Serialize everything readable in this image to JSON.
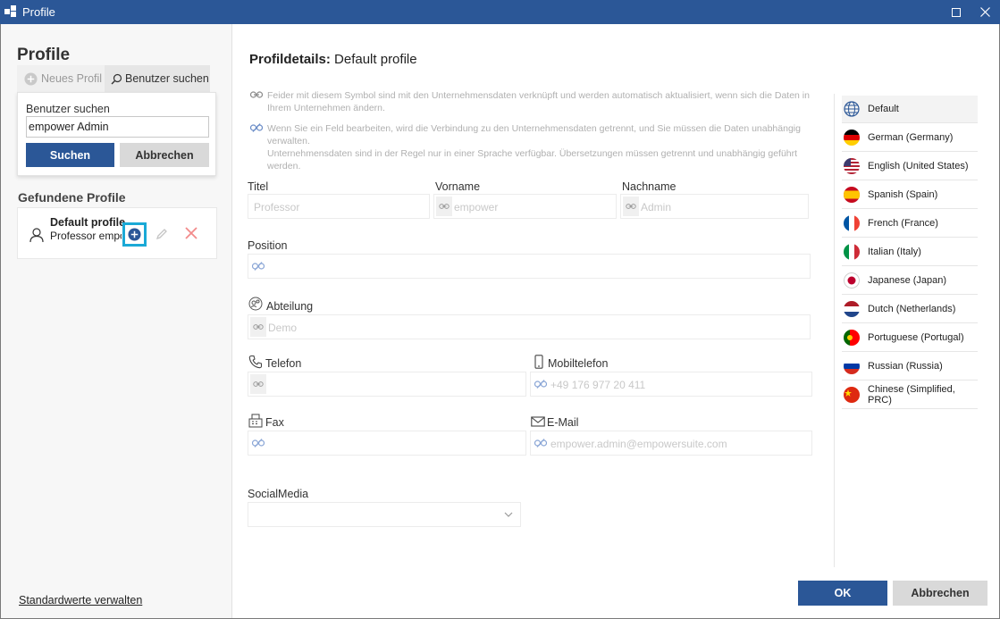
{
  "window": {
    "title": "Profile"
  },
  "left": {
    "heading": "Profile",
    "tabs": {
      "new_profile": "Neues Profil",
      "search_user": "Benutzer suchen"
    },
    "search": {
      "label": "Benutzer suchen",
      "value": "empower Admin",
      "search_button": "Suchen",
      "cancel_button": "Abbrechen"
    },
    "found_title": "Gefundene Profile",
    "result": {
      "name": "Default profile",
      "subtitle": "Professor empower Admin"
    },
    "defaults_link": "Standardwerte verwalten"
  },
  "main": {
    "heading_bold": "Profildetails:",
    "heading_value": " Default profile",
    "info_linked": "Feider mit diesem Symbol sind mit den Unternehmensdaten verknüpft und werden automatisch aktualisiert, wenn sich die Daten in Ihrem Unternehmen ändern.",
    "info_broken_1": "Wenn Sie ein Feld bearbeiten, wird die Verbindung zu den Unternehmensdaten getrennt, und Sie müssen die Daten unabhängig verwalten.",
    "info_broken_2": "Unternehmensdaten sind in der Regel nur in einer Sprache verfügbar. Übersetzungen müssen getrennt und unabhängig geführt werden.",
    "fields": {
      "titel": {
        "label": "Titel",
        "value": "Professor"
      },
      "vorname": {
        "label": "Vorname",
        "value": "empower"
      },
      "nachname": {
        "label": "Nachname",
        "value": "Admin"
      },
      "position": {
        "label": "Position",
        "value": ""
      },
      "abteilung": {
        "label": "Abteilung",
        "value": "Demo"
      },
      "telefon": {
        "label": "Telefon",
        "value": ""
      },
      "mobil": {
        "label": "Mobiltelefon",
        "value": "+49 176 977 20 411"
      },
      "fax": {
        "label": "Fax",
        "value": ""
      },
      "email": {
        "label": "E-Mail",
        "value": "empower.admin@empowersuite.com"
      },
      "social": {
        "label": "SocialMedia",
        "value": ""
      }
    },
    "languages": [
      {
        "name": "Default",
        "icon": "globe-icon"
      },
      {
        "name": "German (Germany)",
        "icon": "flag-de-icon"
      },
      {
        "name": "English (United States)",
        "icon": "flag-us-icon"
      },
      {
        "name": "Spanish (Spain)",
        "icon": "flag-es-icon"
      },
      {
        "name": "French (France)",
        "icon": "flag-fr-icon"
      },
      {
        "name": "Italian (Italy)",
        "icon": "flag-it-icon"
      },
      {
        "name": "Japanese (Japan)",
        "icon": "flag-jp-icon"
      },
      {
        "name": "Dutch (Netherlands)",
        "icon": "flag-nl-icon"
      },
      {
        "name": "Portuguese (Portugal)",
        "icon": "flag-pt-icon"
      },
      {
        "name": "Russian (Russia)",
        "icon": "flag-ru-icon"
      },
      {
        "name": "Chinese (Simplified, PRC)",
        "icon": "flag-cn-icon"
      }
    ],
    "ok_button": "OK",
    "cancel_button": "Abbrechen"
  },
  "colors": {
    "accent": "#2b5797",
    "highlight": "#1aa9d6",
    "delete": "#f28b8b"
  }
}
